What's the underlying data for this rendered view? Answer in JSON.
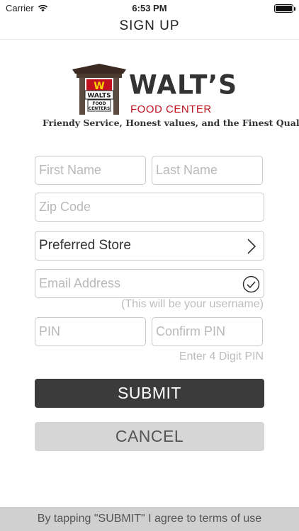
{
  "status_bar": {
    "carrier": "Carrier",
    "time": "6:53 PM"
  },
  "nav": {
    "title": "SIGN UP"
  },
  "logo": {
    "name": "WALT’S",
    "subtitle": "FOOD CENTER",
    "sign_top": "W",
    "sign_name": "WALTS",
    "sign_sub_1": "FOOD",
    "sign_sub_2": "CENTERS",
    "tagline": "Friendy Service, Honest values, and the Finest Quality",
    "colors": {
      "red": "#c0121e",
      "dark": "#333333"
    }
  },
  "form": {
    "first_name": {
      "placeholder": "First Name",
      "value": ""
    },
    "last_name": {
      "placeholder": "Last Name",
      "value": ""
    },
    "zip_code": {
      "placeholder": "Zip Code",
      "value": ""
    },
    "preferred_store": {
      "label": "Preferred Store",
      "icon": "chevron-right-icon"
    },
    "email": {
      "placeholder": "Email Address",
      "value": "",
      "icon": "check-circle-icon"
    },
    "email_helper": "(This will be your username)",
    "pin": {
      "placeholder": "PIN",
      "value": ""
    },
    "confirm_pin": {
      "placeholder": "Confirm PIN",
      "value": ""
    },
    "pin_helper": "Enter 4 Digit PIN"
  },
  "buttons": {
    "submit": "SUBMIT",
    "cancel": "CANCEL"
  },
  "footer": {
    "terms": "By tapping \"SUBMIT\" I agree to terms of use"
  },
  "colors": {
    "submit_bg": "#3b3b3b",
    "cancel_bg": "#d6d6d6",
    "footer_bg": "#d0d0d0",
    "border": "#c9c9c9"
  }
}
